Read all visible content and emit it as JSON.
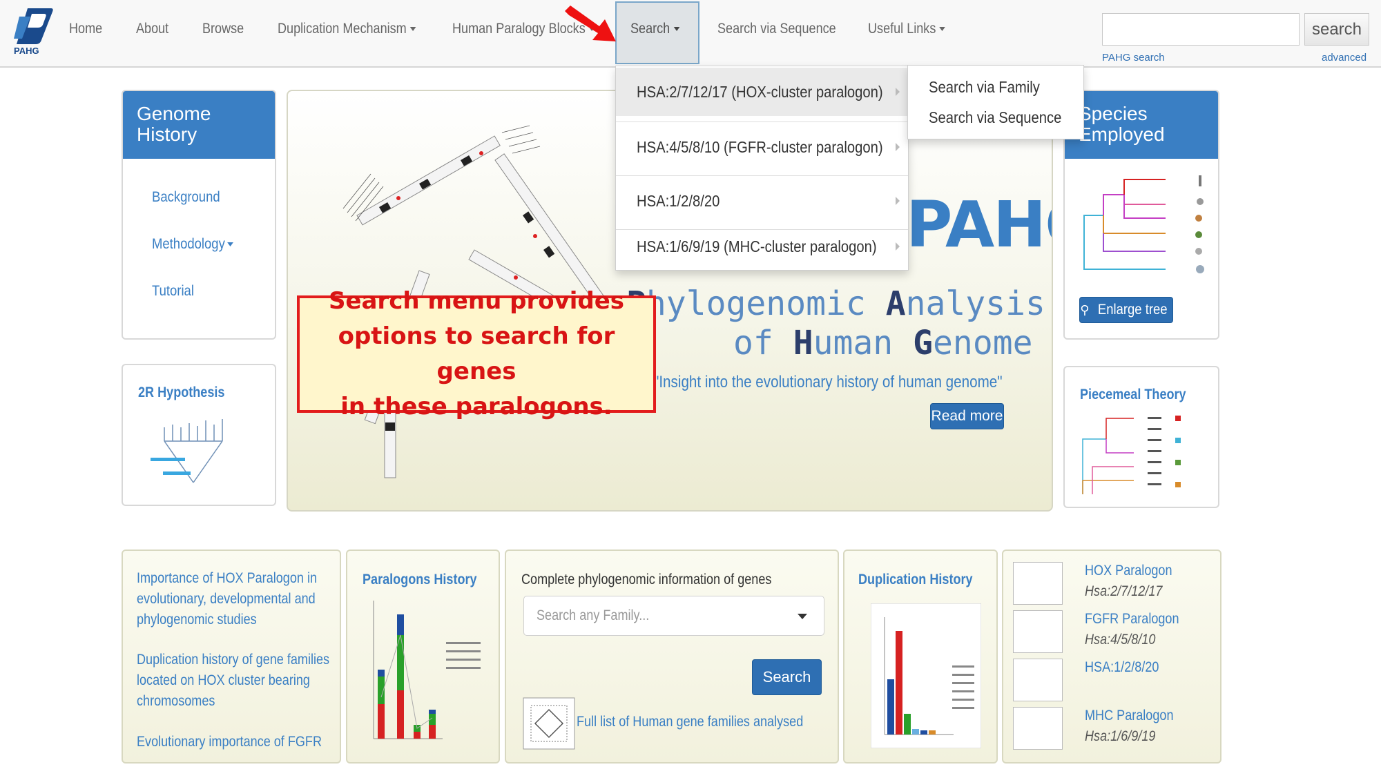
{
  "navbar": {
    "logo_text": "PAHG",
    "items": [
      {
        "label": "Home"
      },
      {
        "label": "About"
      },
      {
        "label": "Browse"
      },
      {
        "label": "Duplication Mechanism"
      },
      {
        "label": "Human Paralogy Blocks"
      },
      {
        "label": "Search"
      },
      {
        "label": "Search via Sequence"
      },
      {
        "label": "Useful Links"
      }
    ],
    "search_button": "search",
    "pahg_search_link": "PAHG search",
    "advanced_link": "advanced"
  },
  "search_dropdown": {
    "items": [
      {
        "label": "HSA:2/7/12/17 (HOX-cluster paralogon)"
      },
      {
        "label": "HSA:4/5/8/10 (FGFR-cluster paralogon)"
      },
      {
        "label": "HSA:1/2/8/20"
      },
      {
        "label": "HSA:1/6/9/19 (MHC-cluster paralogon)"
      }
    ],
    "submenu": [
      {
        "label": "Search via Family"
      },
      {
        "label": "Search via Sequence"
      }
    ]
  },
  "genome_history": {
    "title_line1": "Genome",
    "title_line2": "History",
    "links": [
      {
        "label": "Background"
      },
      {
        "label": "Methodology"
      },
      {
        "label": "Tutorial"
      }
    ]
  },
  "hypothesis_panel": {
    "title": "2R Hypothesis"
  },
  "hero": {
    "logo": "PAHG",
    "sub1_p1": "P",
    "sub1_rest": "hylogenomic ",
    "sub1_a": "A",
    "sub1_rest2": "nalysis",
    "sub2_of": "of ",
    "sub2_h": "H",
    "sub2_rest": "uman ",
    "sub2_g": "G",
    "sub2_rest2": "enome",
    "quote": "\"Insight into the evolutionary history of human genome\"",
    "read_more": "Read more"
  },
  "callout": {
    "line1": "Search menu provides",
    "line2": "options to search for genes",
    "line3": "in these paralogons."
  },
  "species_panel": {
    "title_line1": "Species",
    "title_line2": "Employed",
    "enlarge_button": "Enlarge tree"
  },
  "piecemeal_panel": {
    "title": "Piecemeal Theory"
  },
  "card_hox": {
    "link1_l1": "Importance of HOX Paralogon in",
    "link1_l2": "evolutionary, developmental and",
    "link1_l3": "phylogenomic studies",
    "link2_l1": "Duplication history of gene families",
    "link2_l2": "located on HOX cluster bearing",
    "link2_l3": "chromosomes",
    "link3": "Evolutionary importance of FGFR"
  },
  "card_paralogons": {
    "title": "Paralogons History"
  },
  "card_family": {
    "title": "Complete phylogenomic information of genes",
    "placeholder": "Search any Family...",
    "search_button": "Search",
    "full_list_link": "Full list of Human gene families analysed"
  },
  "card_duplication": {
    "title": "Duplication History"
  },
  "card_paralogs": {
    "items": [
      {
        "name": "HOX Paralogon",
        "chromosomes": "Hsa:2/7/12/17"
      },
      {
        "name": "FGFR Paralogon",
        "chromosomes": "Hsa:4/5/8/10"
      },
      {
        "name": "HSA:1/2/8/20",
        "chromosomes": ""
      },
      {
        "name": "MHC Paralogon",
        "chromosomes": "Hsa:1/6/9/19"
      }
    ]
  },
  "colors": {
    "brand_blue": "#3a7fc4",
    "button_blue": "#2e6fb3",
    "callout_red": "#e21c1c",
    "callout_fill": "#fff6cc",
    "arrow_red": "#ee1111"
  },
  "icons": [
    "logo-icon",
    "caret-down-icon",
    "chevron-right-icon",
    "red-arrow-icon",
    "magnify-icon"
  ]
}
